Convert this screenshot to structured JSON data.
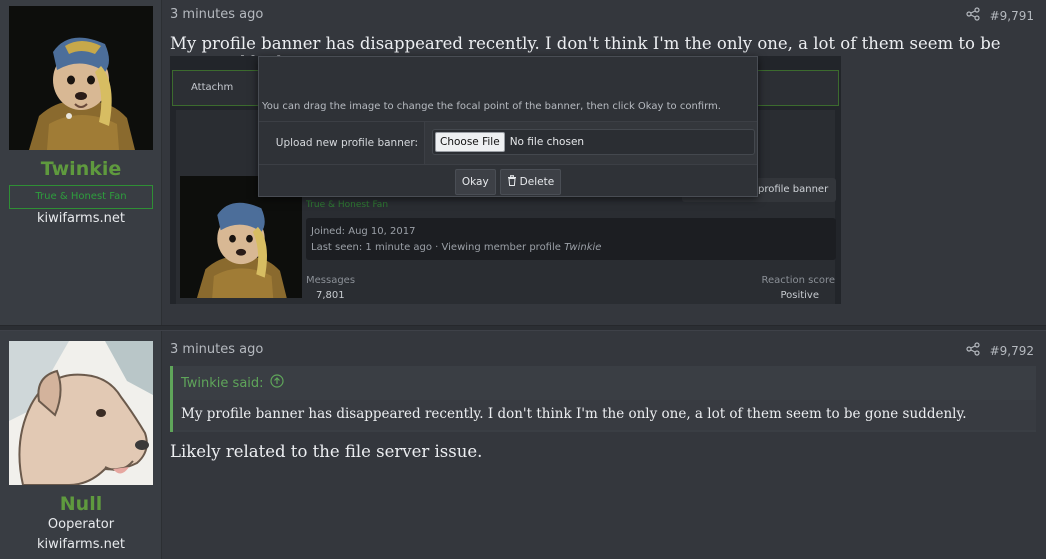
{
  "post1": {
    "username": "Twinkie",
    "user_title": "True & Honest Fan",
    "user_site": "kiwifarms.net",
    "time": "3 minutes ago",
    "post_number": "#9,791",
    "body": "My profile banner has disappeared recently. I don't think I'm the only one, a lot of them seem to be gone suddenly.",
    "screenshot": {
      "attach_label": "Attachm",
      "modal_hint": "You can drag the image to change the focal point of the banner, then click Okay to confirm.",
      "upload_label": "Upload new profile banner:",
      "choose_file": "Choose File",
      "file_status": "No file chosen",
      "okay": "Okay",
      "delete": "Delete",
      "banner_button": "profile banner",
      "joined": "Joined: Aug 10, 2017",
      "last_seen_prefix": "Last seen: 1 minute ago · Viewing member profile",
      "last_seen_user": "Twinkie",
      "messages_label": "Messages",
      "messages_value": "7,801",
      "reaction_label": "Reaction score",
      "reaction_value": "Positive"
    }
  },
  "post2": {
    "username": "Null",
    "user_title": "Ooperator",
    "user_site": "kiwifarms.net",
    "time": "3 minutes ago",
    "post_number": "#9,792",
    "quote_author": "Twinkie said:",
    "quote_text": "My profile banner has disappeared recently. I don't think I'm the only one, a lot of them seem to be gone suddenly.",
    "body": "Likely related to the file server issue."
  },
  "colors": {
    "username_green": "#5f9a3e",
    "quote_border": "#5fa55a",
    "background": "#34373d"
  }
}
